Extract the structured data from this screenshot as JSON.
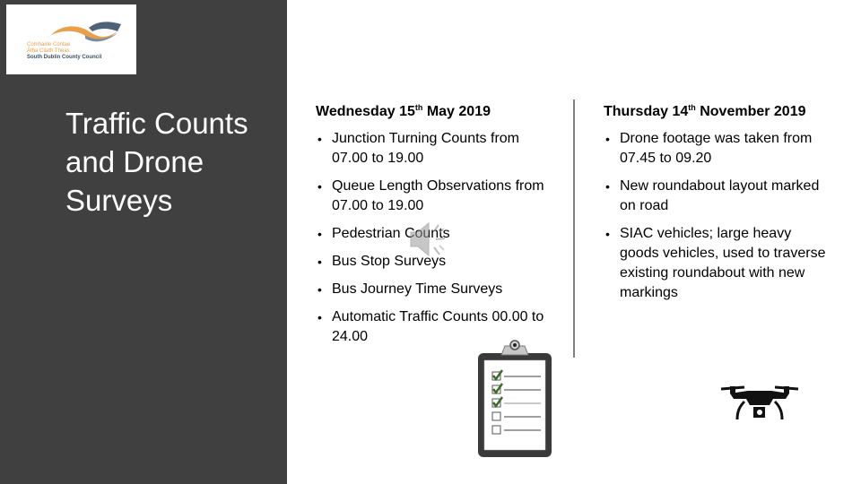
{
  "logo": {
    "line1": "Comhairle Contae",
    "line2": "Átha Cliath Theas",
    "line3": "South Dublin County Council",
    "colors": {
      "orange": "#e8a04a",
      "navy": "#3d4f66"
    }
  },
  "sidebar": {
    "title": "Traffic Counts and Drone Surveys",
    "background": "#404040"
  },
  "left_column": {
    "heading_prefix": "Wednesday 15",
    "heading_sup": "th",
    "heading_suffix": " May 2019",
    "bullets": [
      "Junction Turning Counts from 07.00 to 19.00",
      "Queue Length Observations from 07.00 to 19.00",
      "Pedestrian Counts",
      "Bus Stop Surveys",
      "Bus Journey Time Surveys",
      "Automatic Traffic Counts 00.00 to 24.00"
    ]
  },
  "right_column": {
    "heading_prefix": "Thursday 14",
    "heading_sup": "th",
    "heading_suffix": " November 2019",
    "bullets": [
      "Drone footage was taken from 07.45 to 09.20",
      "New roundabout layout marked on road",
      "SIAC vehicles; large heavy goods vehicles, used to traverse existing roundabout with new markings"
    ]
  },
  "icons": {
    "audio": "speaker-icon",
    "checklist": "clipboard-checklist-icon",
    "drone": "drone-icon",
    "checked_items": 3,
    "total_items": 5
  },
  "bullet_char": "•"
}
